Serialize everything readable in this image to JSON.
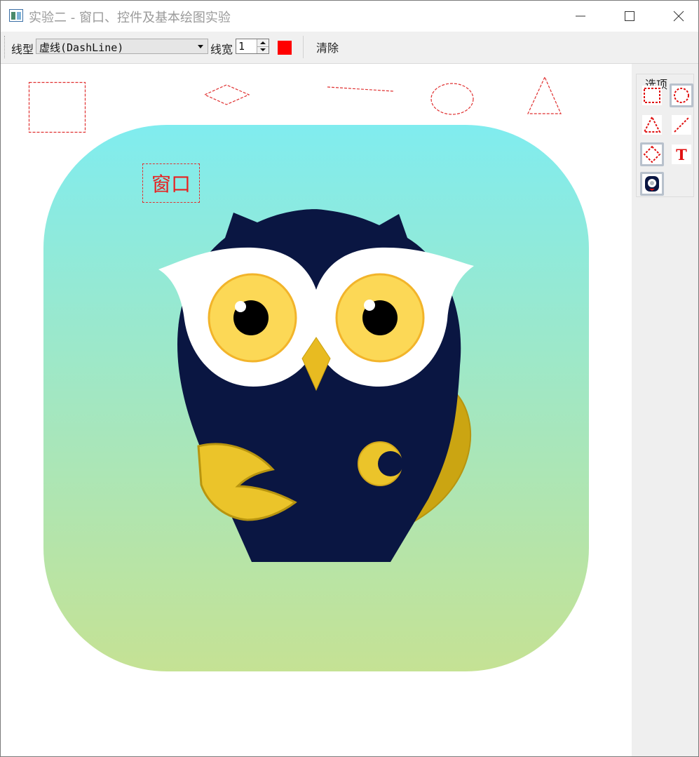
{
  "window": {
    "title": "实验二 - 窗口、控件及基本绘图实验",
    "controls": [
      "minimize-icon",
      "maximize-icon",
      "close-icon"
    ]
  },
  "toolbar": {
    "line_style_label": "线型",
    "line_style_value": "虚线(DashLine)",
    "line_width_label": "线宽",
    "line_width_value": "1",
    "pen_color": "#ff0000",
    "clear_label": "清除"
  },
  "canvas": {
    "text_item": "窗口",
    "shape_stroke": "#e03030",
    "shapes": [
      "rectangle",
      "diamond",
      "line",
      "ellipse",
      "triangle",
      "text",
      "owl-image"
    ]
  },
  "dock": {
    "group_title": "选项",
    "tools": [
      {
        "name": "rectangle-tool",
        "icon": "rectangle-icon",
        "selected": false
      },
      {
        "name": "ellipse-tool",
        "icon": "ellipse-icon",
        "selected": true
      },
      {
        "name": "triangle-tool",
        "icon": "triangle-icon",
        "selected": false
      },
      {
        "name": "line-tool",
        "icon": "line-icon",
        "selected": false
      },
      {
        "name": "diamond-tool",
        "icon": "diamond-icon",
        "selected": true
      },
      {
        "name": "text-tool",
        "icon": "text-icon",
        "label": "T",
        "selected": false
      },
      {
        "name": "image-tool",
        "icon": "image-icon",
        "selected": true
      }
    ]
  },
  "colors": {
    "accent": "#ff0000",
    "gradient_top": "#80ecef",
    "gradient_bottom": "#c5e294",
    "owl_body": "#0a1642",
    "owl_yellow": "#ebc42a"
  }
}
